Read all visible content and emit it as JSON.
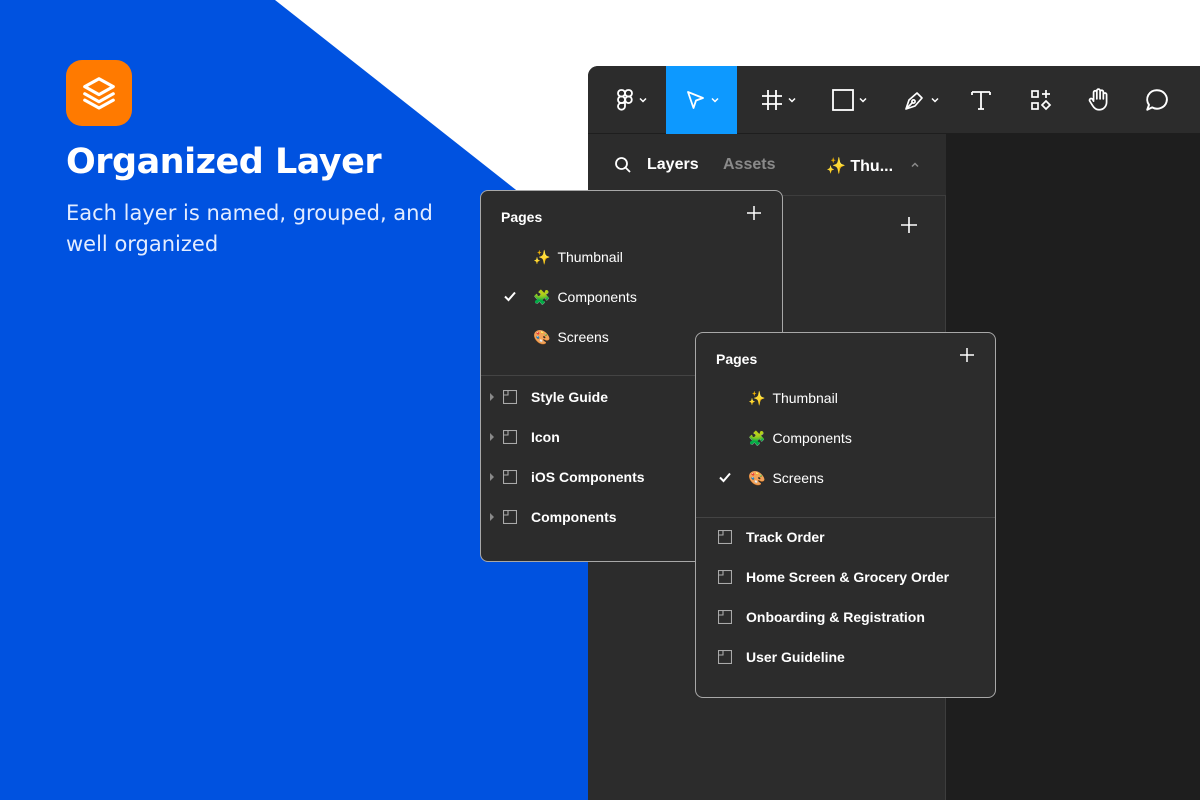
{
  "colors": {
    "brand_blue": "#0052e0",
    "logo_orange": "#ff7a00",
    "ui_dark": "#2c2c2c",
    "canvas_dark": "#1e1e1e",
    "active_tool": "#0d99ff"
  },
  "hero": {
    "logo_icon": "layers-icon",
    "title": "Organized Layer",
    "subtitle": "Each layer is named, grouped, and well organized"
  },
  "toolbar": {
    "tools": [
      {
        "icon": "figma-menu-icon"
      },
      {
        "icon": "move-cursor-icon",
        "active": true
      },
      {
        "icon": "frame-icon"
      },
      {
        "icon": "rectangle-icon"
      },
      {
        "icon": "pen-icon"
      },
      {
        "icon": "text-icon"
      },
      {
        "icon": "resources-icon"
      },
      {
        "icon": "hand-icon"
      },
      {
        "icon": "comment-icon"
      }
    ]
  },
  "panel": {
    "tab_layers": "Layers",
    "tab_assets": "Assets",
    "page_selector": "✨ Thu..."
  },
  "popup_a": {
    "heading": "Pages",
    "pages": [
      {
        "emoji": "✨",
        "label": "Thumbnail",
        "checked": false
      },
      {
        "emoji": "🧩",
        "label": "Components",
        "checked": true
      },
      {
        "emoji": "🎨",
        "label": "Screens",
        "checked": false
      }
    ],
    "frames": [
      "Style Guide",
      "Icon",
      "iOS Components",
      "Components"
    ]
  },
  "popup_b": {
    "heading": "Pages",
    "pages": [
      {
        "emoji": "✨",
        "label": "Thumbnail",
        "checked": false
      },
      {
        "emoji": "🧩",
        "label": "Components",
        "checked": false
      },
      {
        "emoji": "🎨",
        "label": "Screens",
        "checked": true
      }
    ],
    "frames": [
      "Track Order",
      "Home Screen & Grocery Order",
      "Onboarding & Registration",
      "User Guideline"
    ]
  }
}
